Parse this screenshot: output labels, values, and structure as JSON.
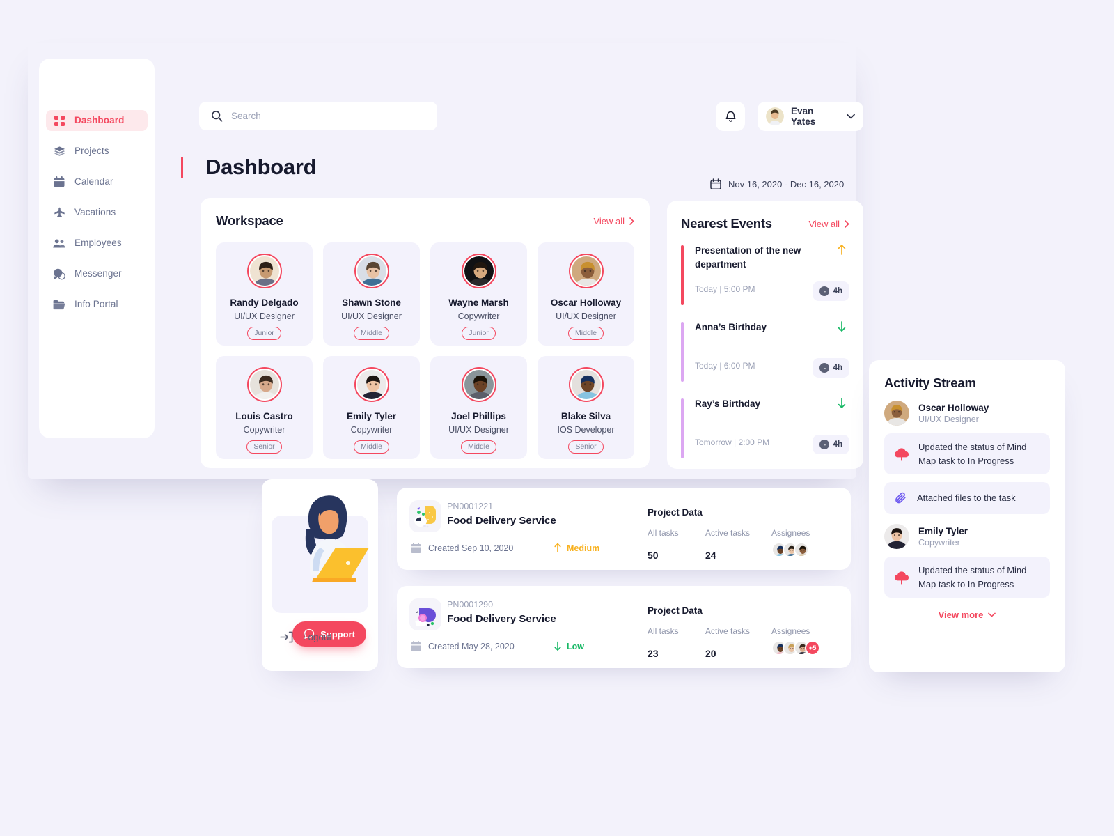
{
  "search": {
    "placeholder": "Search",
    "value": "",
    "icon": "search-icon"
  },
  "topbar": {
    "bell_icon": "bell-icon",
    "user_name": "Evan Yates",
    "chevron_icon": "chevron-down-icon"
  },
  "page": {
    "title": "Dashboard"
  },
  "date_range": {
    "icon": "calendar-icon",
    "text": "Nov 16, 2020 - Dec 16, 2020"
  },
  "sidebar": {
    "items": [
      {
        "label": "Dashboard",
        "icon": "grid-icon",
        "active": true
      },
      {
        "label": "Projects",
        "icon": "layers-icon",
        "active": false
      },
      {
        "label": "Calendar",
        "icon": "calendar-icon",
        "active": false
      },
      {
        "label": "Vacations",
        "icon": "airplane-icon",
        "active": false
      },
      {
        "label": "Employees",
        "icon": "people-icon",
        "active": false
      },
      {
        "label": "Messenger",
        "icon": "chat-icon",
        "active": false
      },
      {
        "label": "Info Portal",
        "icon": "folder-icon",
        "active": false
      }
    ]
  },
  "workspace": {
    "title": "Workspace",
    "view_all": "View all",
    "people": [
      {
        "name": "Randy Delgado",
        "role": "UI/UX Designer",
        "level": "Junior",
        "skin": "#c79a71",
        "hair": "#2d2017",
        "shirt": "#6a6f86",
        "bg": "#efe3d2"
      },
      {
        "name": "Shawn Stone",
        "role": "UI/UX Designer",
        "level": "Middle",
        "skin": "#e8c2a4",
        "hair": "#5a4632",
        "shirt": "#3f6f95",
        "bg": "#d9dee6"
      },
      {
        "name": "Wayne Marsh",
        "role": "Copywriter",
        "level": "Junior",
        "skin": "#d6a87e",
        "hair": "#20160f",
        "shirt": "#2a2a2c",
        "bg": "#111114"
      },
      {
        "name": "Oscar Holloway",
        "role": "UI/UX Designer",
        "level": "Middle",
        "skin": "#8b5e3c",
        "hair": "#c8902f",
        "shirt": "#e8e6e4",
        "bg": "#cfa97e"
      },
      {
        "name": "Louis Castro",
        "role": "Copywriter",
        "level": "Senior",
        "skin": "#d7a98b",
        "hair": "#3a2a1f",
        "shirt": "#f1f0ee",
        "bg": "#e6e2dc"
      },
      {
        "name": "Emily Tyler",
        "role": "Copywriter",
        "level": "Middle",
        "skin": "#edc3a4",
        "hair": "#1d1512",
        "shirt": "#222233",
        "bg": "#eceaea"
      },
      {
        "name": "Joel Phillips",
        "role": "UI/UX Designer",
        "level": "Middle",
        "skin": "#6b4226",
        "hair": "#1a1208",
        "shirt": "#5c5f6a",
        "bg": "#8a959a"
      },
      {
        "name": "Blake Silva",
        "role": "IOS Developer",
        "level": "Senior",
        "skin": "#6e4528",
        "hair": "#16305e",
        "shirt": "#86c3e0",
        "bg": "#e4e0dd"
      }
    ]
  },
  "events": {
    "title": "Nearest Events",
    "view_all": "View all",
    "items": [
      {
        "title": "Presentation of the new department",
        "time": "Today | 5:00 PM",
        "duration": "4h",
        "bar_color": "#f4485f",
        "trend": "up",
        "trend_color": "#f8b11f"
      },
      {
        "title": "Anna’s Birthday",
        "time": "Today | 6:00 PM",
        "duration": "4h",
        "bar_color": "#dca7f2",
        "trend": "down",
        "trend_color": "#17b865"
      },
      {
        "title": "Ray’s Birthday",
        "time": "Tomorrow | 2:00 PM",
        "duration": "4h",
        "bar_color": "#dca7f2",
        "trend": "down",
        "trend_color": "#17b865"
      }
    ]
  },
  "support": {
    "button_label": "Support",
    "button_icon": "chat-bubble-icon",
    "logout_label": "Logout",
    "logout_icon": "logout-icon"
  },
  "projects": {
    "data_title": "Project Data",
    "labels": {
      "all_tasks": "All tasks",
      "active_tasks": "Active tasks",
      "assignees": "Assignees"
    },
    "items": [
      {
        "code": "PN0001221",
        "name": "Food Delivery Service",
        "created": "Created Sep 10, 2020",
        "priority": "Medium",
        "priority_color": "#f8b11f",
        "priority_trend": "up",
        "all_tasks": "50",
        "active_tasks": "24",
        "icon": "project-icon-yellow",
        "assignees": [
          {
            "skin": "#6b4226",
            "hair": "#16305e",
            "shirt": "#86c3e0"
          },
          {
            "skin": "#e8c2a4",
            "hair": "#2a2118",
            "shirt": "#3f6f95"
          },
          {
            "skin": "#8b5e3c",
            "hair": "#1a1208",
            "shirt": "#d9c7a8"
          }
        ],
        "extra": null
      },
      {
        "code": "PN0001290",
        "name": "Food Delivery Service",
        "created": "Created May 28, 2020",
        "priority": "Low",
        "priority_color": "#17b865",
        "priority_trend": "down",
        "all_tasks": "23",
        "active_tasks": "20",
        "icon": "project-icon-purple",
        "assignees": [
          {
            "skin": "#6b4226",
            "hair": "#16305e",
            "shirt": "#efb8c6"
          },
          {
            "skin": "#e8c2a4",
            "hair": "#c8a15a",
            "shirt": "#e6e3de"
          },
          {
            "skin": "#d7a98b",
            "hair": "#3a2a1f",
            "shirt": "#2d2d3a"
          }
        ],
        "extra": "+5"
      }
    ]
  },
  "activity": {
    "title": "Activity Stream",
    "view_more": "View more",
    "chevron_icon": "chevron-down-icon",
    "entries": [
      {
        "type": "user",
        "name": "Oscar Holloway",
        "role": "UI/UX Designer",
        "skin": "#8b5e3c",
        "hair": "#c8902f",
        "shirt": "#e8e6e4",
        "bg": "#cfa97e"
      },
      {
        "type": "action",
        "icon": "cloud-upload-icon",
        "icon_color": "#f4485f",
        "text": "Updated the status of Mind Map task to In Progress"
      },
      {
        "type": "action",
        "icon": "paperclip-icon",
        "icon_color": "#6f5bf0",
        "text": "Attached files to the task"
      },
      {
        "type": "user",
        "name": "Emily Tyler",
        "role": "Copywriter",
        "skin": "#edc3a4",
        "hair": "#1d1512",
        "shirt": "#222233",
        "bg": "#eceaea"
      },
      {
        "type": "action",
        "icon": "cloud-upload-icon",
        "icon_color": "#f4485f",
        "text": "Updated the status of Mind Map task to In Progress"
      }
    ]
  },
  "colors": {
    "accent": "#f4485f",
    "background": "#f3f2fb",
    "panel": "#ffffff",
    "muted": "#9aa0b5",
    "text": "#171a2e"
  }
}
